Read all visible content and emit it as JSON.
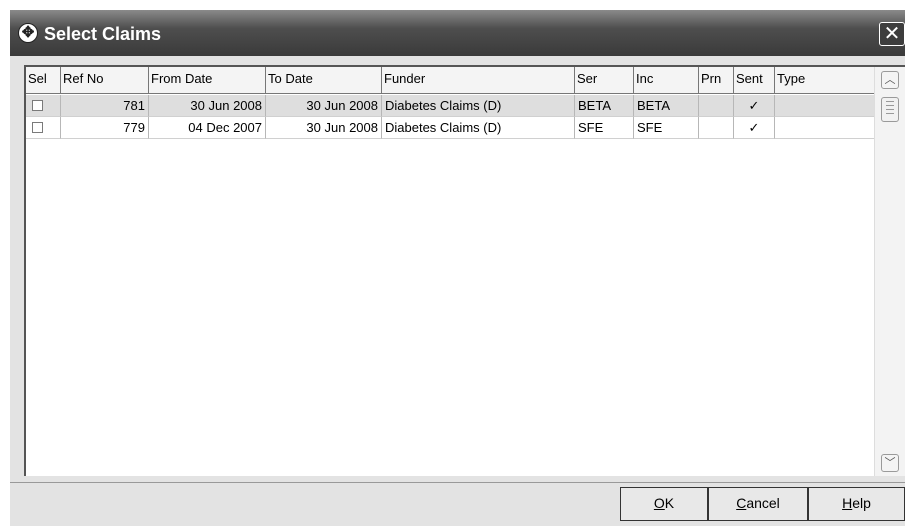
{
  "window": {
    "title": "Select Claims",
    "close_glyph": "✕",
    "title_icon": "move-icon"
  },
  "grid": {
    "columns": [
      "Sel",
      "Ref No",
      "From Date",
      "To Date",
      "Funder",
      "Ser",
      "Inc",
      "Prn",
      "Sent",
      "Type"
    ],
    "rows": [
      {
        "ref": "781",
        "from": "30 Jun 2008",
        "to": "30 Jun 2008",
        "funder": "Diabetes Claims (D)",
        "ser": "BETA",
        "inc": "BETA",
        "prn": "",
        "sent": "✓",
        "type": "",
        "checked": false
      },
      {
        "ref": "779",
        "from": "04 Dec 2007",
        "to": "30 Jun 2008",
        "funder": "Diabetes Claims (D)",
        "ser": "SFE",
        "inc": "SFE",
        "prn": "",
        "sent": "✓",
        "type": "",
        "checked": false
      }
    ]
  },
  "scrollbar": {
    "up_glyph": "︿",
    "down_glyph": "﹀"
  },
  "buttons": {
    "ok": {
      "mnemonic": "O",
      "rest": "K"
    },
    "cancel": {
      "mnemonic": "C",
      "rest": "ancel"
    },
    "help": {
      "mnemonic": "H",
      "rest": "elp"
    }
  }
}
